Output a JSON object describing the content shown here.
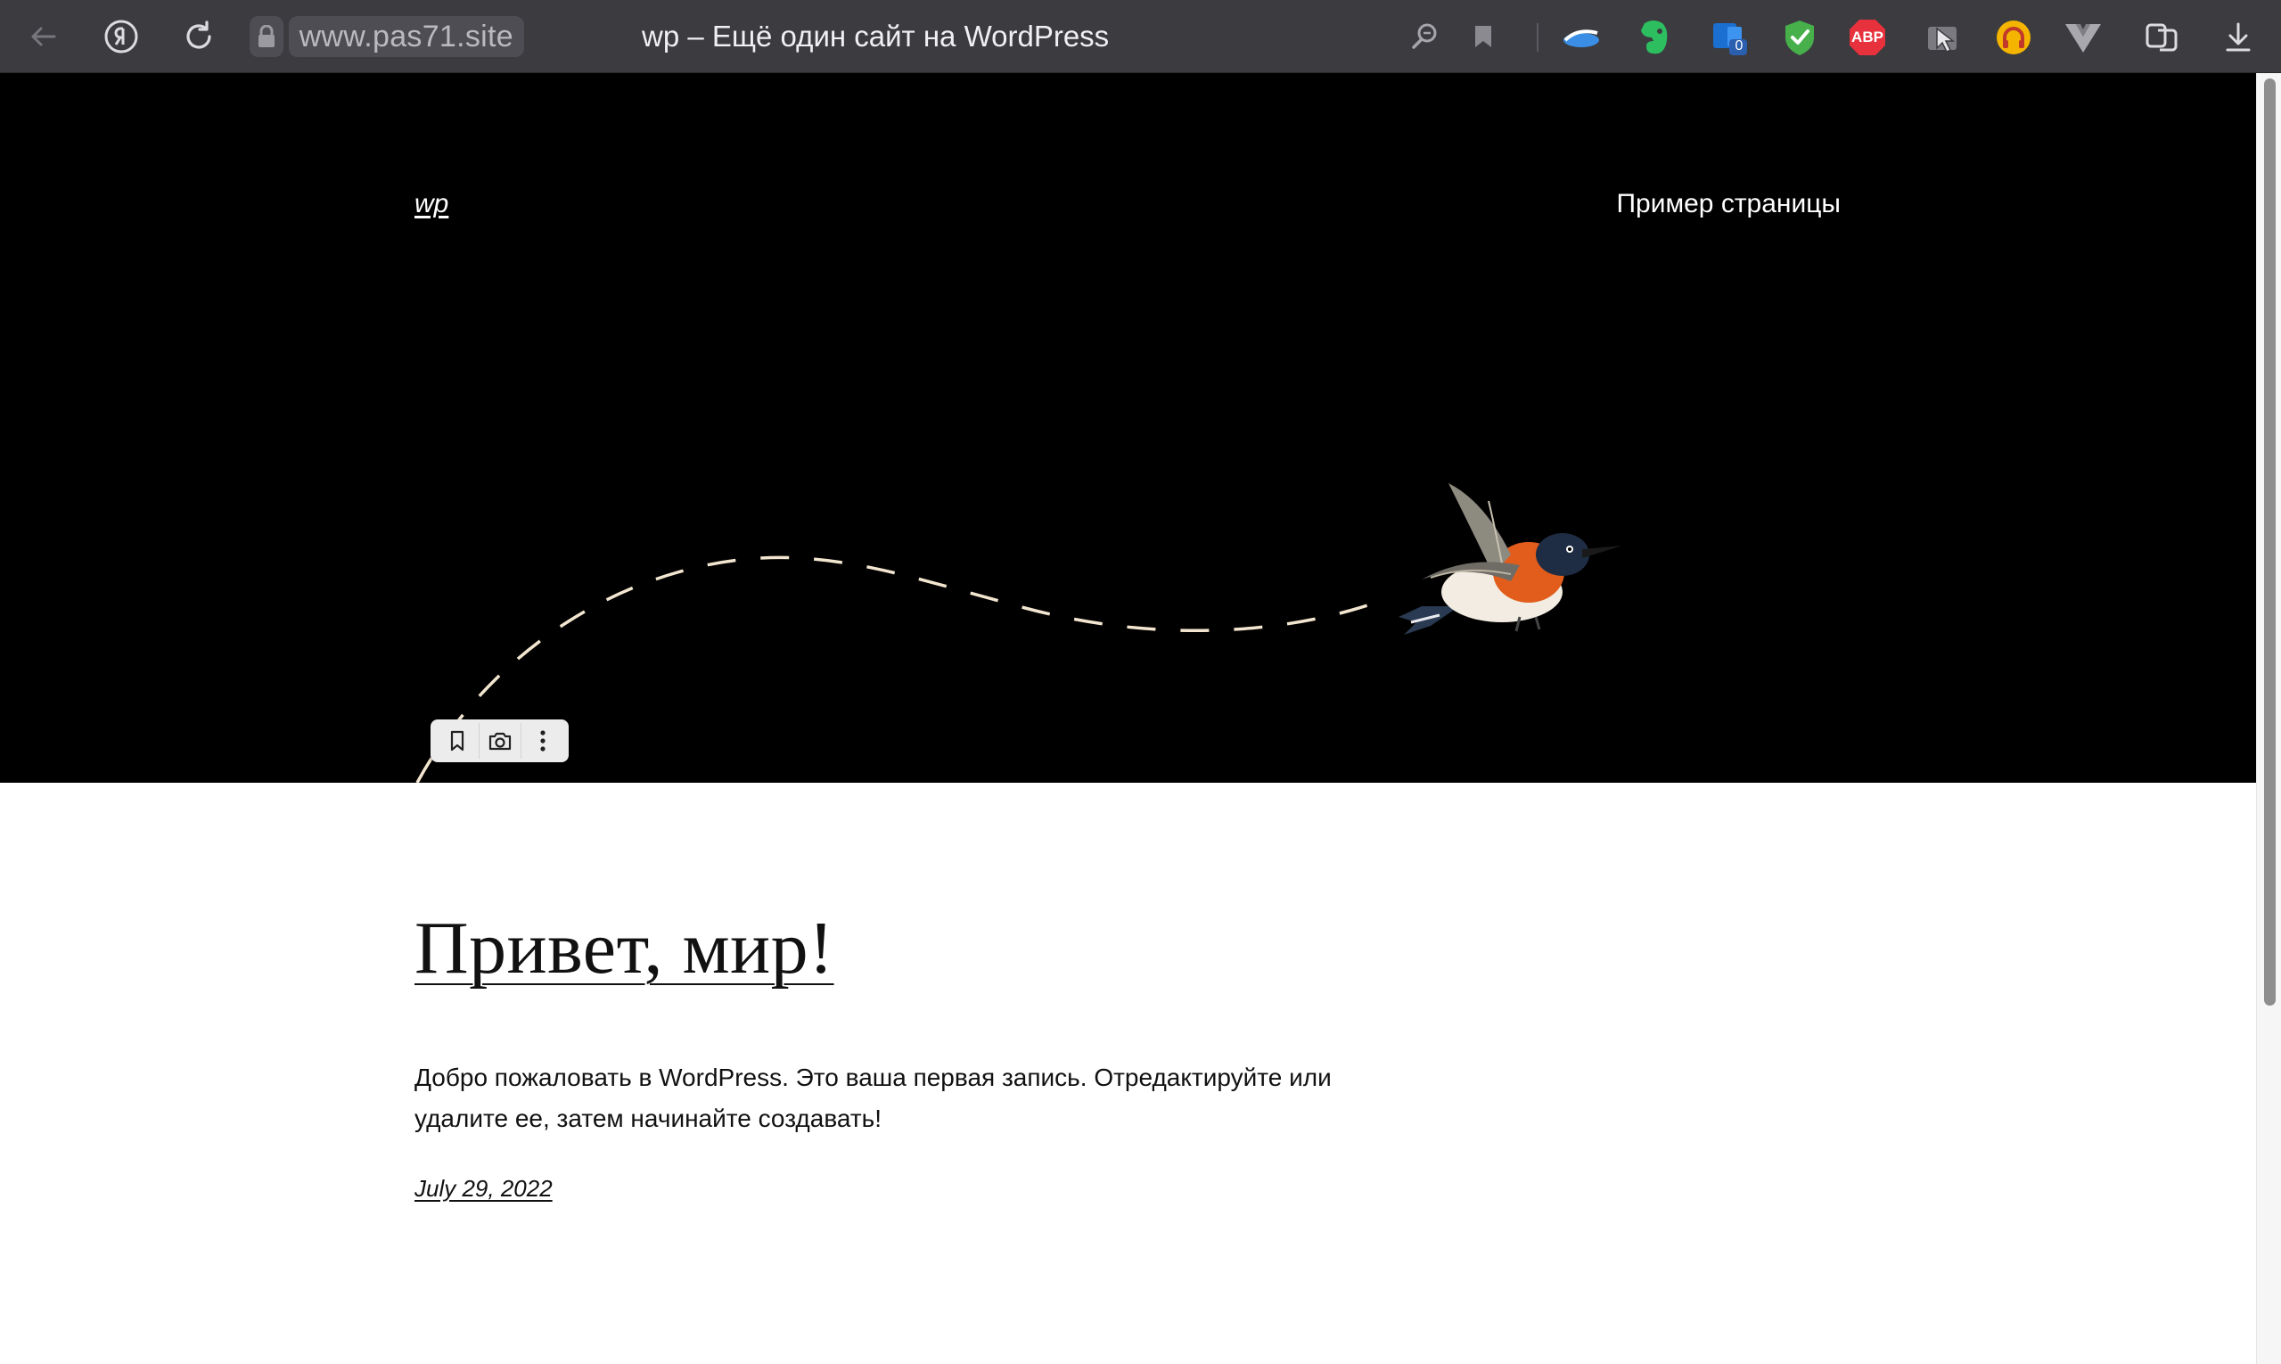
{
  "browser": {
    "url": "www.pas71.site",
    "tab_title": "wp – Ещё один сайт на WordPress",
    "extensions": {
      "office_badge": "0",
      "abp_label": "ABP"
    },
    "toolbar_icons": [
      "back-icon",
      "yandex-icon",
      "reload-icon",
      "lock-icon",
      "reader-icon",
      "bookmark-icon",
      "downloads-icon"
    ],
    "extension_icons": [
      "cloud-extension-icon",
      "evernote-icon",
      "office-icon",
      "shield-check-icon",
      "adblock-plus-icon",
      "cursor-extension-icon",
      "headphones-extension-icon",
      "vue-devtools-icon",
      "tab-manager-icon"
    ]
  },
  "site": {
    "name": "wp",
    "nav": {
      "sample_page": "Пример страницы"
    }
  },
  "image_toolbar": {
    "icons": [
      "bookmark-icon",
      "camera-icon",
      "more-icon"
    ]
  },
  "post": {
    "title": "Привет, мир!",
    "body": "Добро пожаловать в WordPress. Это ваша первая запись. Отредактируйте или удалите ее, затем начинайте создавать!",
    "date": "July 29, 2022"
  },
  "colors": {
    "toolbar_bg": "#3b3b40",
    "header_bg": "#000000",
    "page_bg": "#ffffff",
    "flight_path": "#f3e6d0",
    "abp_red": "#e7313c",
    "evernote_green": "#2dbe60"
  }
}
